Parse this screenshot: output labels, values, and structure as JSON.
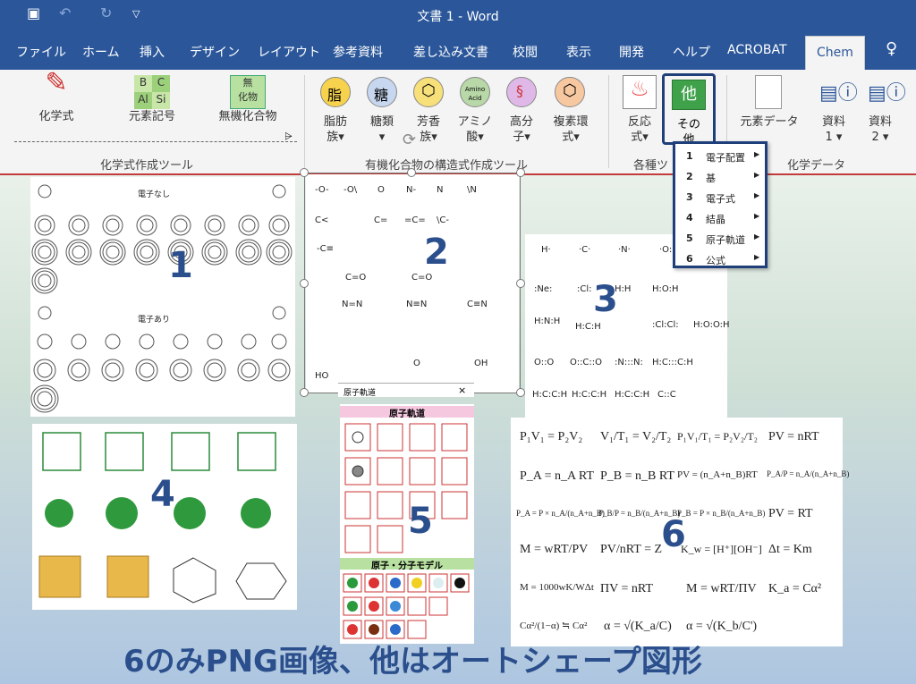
{
  "title": "文書 1 - Word",
  "tabs": [
    "ファイル",
    "ホーム",
    "挿入",
    "デザイン",
    "レイアウト",
    "参考資料",
    "差し込み文書",
    "校閲",
    "表示",
    "開発",
    "ヘルプ",
    "ACROBAT",
    "Chem"
  ],
  "ribbon": {
    "kagakushiki": "化学式",
    "genso": "元素記号",
    "muki": "無機化合物",
    "elem_a": "B",
    "elem_b": "C",
    "elem_c": "Al",
    "elem_d": "Si",
    "muki_icon_a": "無",
    "muki_icon_b": "化物",
    "shibo_a": "脂肪",
    "shibo_b": "族",
    "shibo_icon": "脂",
    "touka_a": "糖類",
    "touka_icon": "糖",
    "houkou_a": "芳香",
    "houkou_b": "族",
    "amino_a": "アミノ",
    "amino_b": "酸",
    "amino_icon": "Amino Acid",
    "koubun_a": "高分",
    "koubun_b": "子",
    "fukuso_a": "複素環",
    "fukuso_b": "式",
    "hanno_a": "反応",
    "hanno_b": "式",
    "sono_a": "その",
    "sono_b": "他",
    "sono_icon": "他",
    "gensodata": "元素データ",
    "shiryo1_a": "資料",
    "shiryo1_b": "1",
    "shiryo2_a": "資料",
    "shiryo2_b": "2",
    "group1": "化学式作成ツール",
    "group2": "有機化合物の構造式作成ツール",
    "group3": "各種ツ",
    "group4": "化学データ"
  },
  "menu": [
    {
      "n": "1",
      "l": "電子配置"
    },
    {
      "n": "2",
      "l": "基"
    },
    {
      "n": "3",
      "l": "電子式"
    },
    {
      "n": "4",
      "l": "結晶"
    },
    {
      "n": "5",
      "l": "原子軌道"
    },
    {
      "n": "6",
      "l": "公式"
    }
  ],
  "panels": {
    "p1_top": "電子なし",
    "p1_mid": "電子あり",
    "n1": "1",
    "n2": "2",
    "n3": "3",
    "n4": "4",
    "n5": "5",
    "n6": "6",
    "p2_tab": "原子軌道",
    "p2_close": "×",
    "p5_title": "原子軌道",
    "p5_title2": "原子・分子モデル"
  },
  "symbols_2": [
    "-O-",
    "-O\\",
    "O",
    "N-",
    "N",
    "\\N",
    "C=",
    "C<",
    "=C=",
    "\\C-",
    "-C≡",
    "C=O",
    "C=O",
    "N=N",
    "N≡N",
    "C≡N",
    "HO",
    "O",
    "OH"
  ],
  "lewis": [
    "H·",
    "·C·",
    "·N·",
    "·O:",
    ":Ne:",
    ":Cl:",
    "H:H",
    "H:O:H",
    "H:N:H",
    "H:C:H",
    ":Cl:Cl:",
    "H:O:O:H",
    "O::O",
    "O::C::O",
    ":N:::N:",
    "H:C:::C:H",
    "H:C:C:H",
    "H:C:C:H",
    "H:C:C:H",
    "C::C"
  ],
  "formulas": {
    "f1": "P₁V₁ = P₂V₂",
    "f2": "V₁/T₁ = V₂/T₂",
    "f3": "P₁V₁/T₁ = P₂V₂/T₂",
    "f4": "PV = nRT",
    "f5": "P_A = n_A RT",
    "f6": "P_B = n_B RT",
    "f7": "PV = (n_A+n_B)RT",
    "f8": "P_A/P = n_A/(n_A+n_B)",
    "f9": "P_A = P × n_A/(n_A+n_B)",
    "f10": "P_B/P = n_B/(n_A+n_B)",
    "f11": "P_B = P × n_B/(n_A+n_B)",
    "f12": "PV =   RT",
    "f13": "M = wRT/PV",
    "f14": "PV/nRT = Z",
    "f15": "K_w = [H⁺][OH⁻]",
    "f16": "Δt = Km",
    "f17": "M = 1000wK/WΔt",
    "f18": "ΠV = nRT",
    "f19": "M = wRT/ΠV",
    "f20": "K_a = Cα²",
    "f21": "Cα²/(1−α) ≒ Cα²",
    "f22": "α = √(K_a/C)",
    "f23": "α = √(K_b/C')"
  },
  "caption": "6のみPNG画像、他はオートシェープ図形",
  "colors": {
    "accent": "#2b579a",
    "border": "#1f3f7a",
    "number": "#2b4f8c"
  }
}
